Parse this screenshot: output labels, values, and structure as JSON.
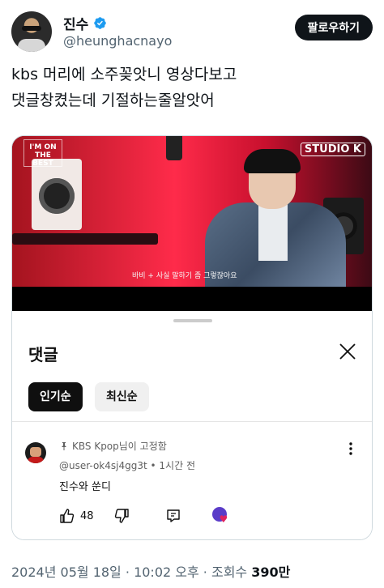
{
  "tweet": {
    "author": {
      "display_name": "진수",
      "handle": "@heunghacnayo",
      "verified_icon": "verified-badge-icon"
    },
    "follow_label": "팔로우하기",
    "text_lines": [
      "kbs 머리에 소주꽂앗니 영상다보고",
      "댓글창켰는데 기절하는줄알앗어"
    ],
    "footer": {
      "date": "2024년 05월 18일",
      "time": "10:02 오후",
      "views_label": "조회수",
      "views_count": "390만",
      "separator": "·"
    }
  },
  "video": {
    "show_logo_left": "I'M ON THE BEST",
    "show_logo_right": "STUDIO K",
    "subtitle": "바비 + 사실 말하기 좀 그렇잖아요"
  },
  "comments_sheet": {
    "title": "댓글",
    "sort_chips": [
      "인기순",
      "최신순"
    ],
    "selected_chip": "인기순",
    "comment": {
      "pinned_by": "KBS Kpop님이 고정함",
      "username": "@user-ok4sj4gg3t",
      "time_ago": "1시간 전",
      "body": "진수와 쑨디",
      "likes": "48"
    }
  },
  "colors": {
    "follow_bg": "#0f1419",
    "verified": "#1d9bf0",
    "chip_selected": "#0f0f0f",
    "chip_unselected": "#f0f0f0",
    "heart": "#e0245e"
  }
}
